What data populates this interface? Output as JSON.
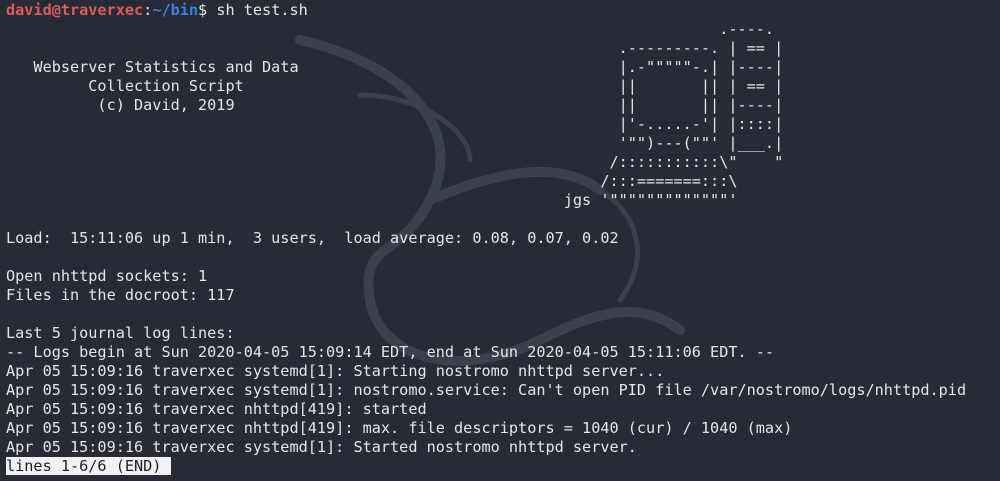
{
  "prompt": {
    "user_host": "david@traverxec",
    "separator": ":",
    "path": "~/bin",
    "symbol": "$ ",
    "command": "sh test.sh"
  },
  "lines": [
    "                                                                              .----.",
    "                                                                   .---------. | == |",
    "   Webserver Statistics and Data                                   |.-\"\"\"\"\"-.| |----|",
    "         Collection Script                                         ||       || | == |",
    "          (c) David, 2019                                          ||       || |----|",
    "                                                                   |'-.....-'| |::::|",
    "                                                                   '\"\")---(\"\"' |___.|",
    "                                                                  /:::::::::::\\\"    \"",
    "                                                                 /:::=======:::\\",
    "                                                             jgs '\"\"\"\"\"\"\"\"\"\"\"\"\"'",
    "",
    "Load:  15:11:06 up 1 min,  3 users,  load average: 0.08, 0.07, 0.02",
    "",
    "Open nhttpd sockets: 1",
    "Files in the docroot: 117",
    "",
    "Last 5 journal log lines:",
    "-- Logs begin at Sun 2020-04-05 15:09:14 EDT, end at Sun 2020-04-05 15:11:06 EDT. --",
    "Apr 05 15:09:16 traverxec systemd[1]: Starting nostromo nhttpd server...",
    "Apr 05 15:09:16 traverxec systemd[1]: nostromo.service: Can't open PID file /var/nostromo/logs/nhttpd.pid",
    "Apr 05 15:09:16 traverxec nhttpd[419]: started",
    "Apr 05 15:09:16 traverxec nhttpd[419]: max. file descriptors = 1040 (cur) / 1040 (max)",
    "Apr 05 15:09:16 traverxec systemd[1]: Started nostromo nhttpd server."
  ],
  "status_line": "lines 1-6/6 (END)",
  "colors": {
    "background": "#262b36",
    "foreground": "#e6e6e6",
    "prompt_user": "#e05a5a",
    "prompt_path": "#3d7fe0",
    "status_bg": "#f2f2f2"
  },
  "icons": {
    "background": "kali-dragon-logo"
  }
}
